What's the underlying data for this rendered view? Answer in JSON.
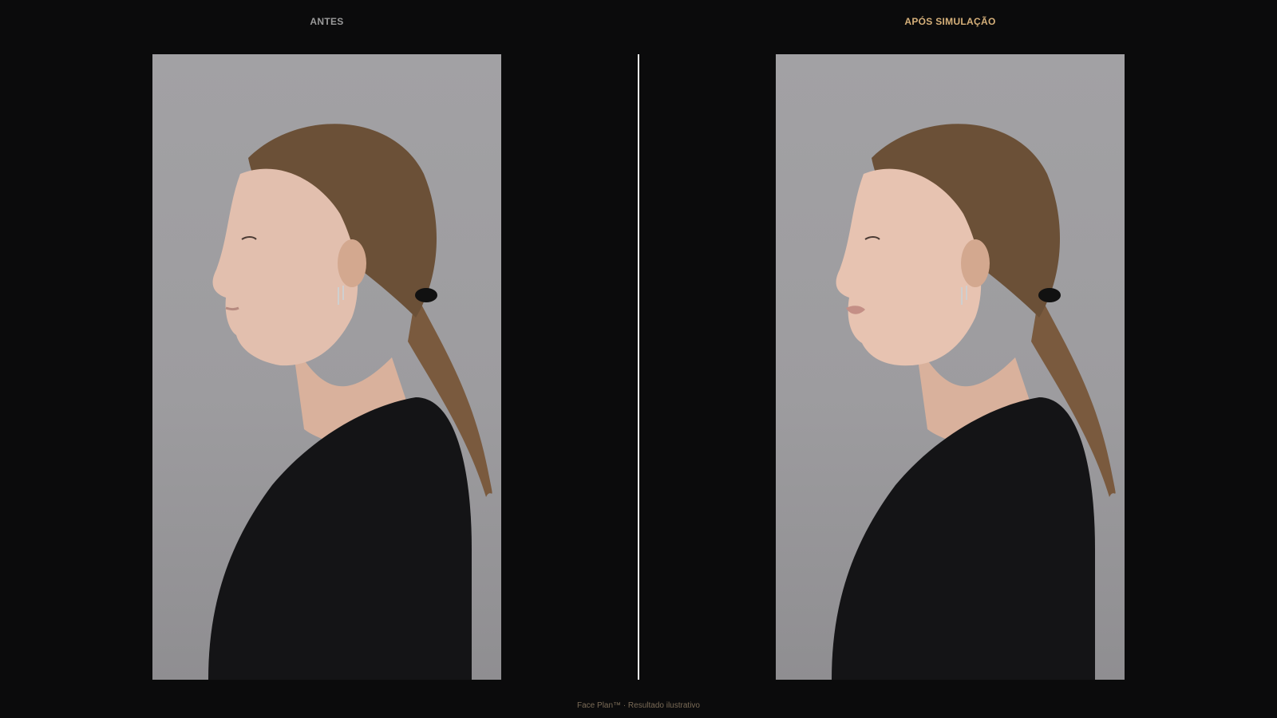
{
  "panels": {
    "before": {
      "label": "ANTES",
      "label_color": "#9a9a9a"
    },
    "after": {
      "label": "APÓS SIMULAÇÃO",
      "label_color": "#d6b07a"
    }
  },
  "footer": {
    "text": "Face Plan™ · Resultado ilustrativo"
  },
  "colors": {
    "background": "#0b0b0c",
    "photo_backdrop": "#a2a1a4",
    "divider": "#f2f2f2",
    "accent": "#d6b07a"
  },
  "images": {
    "before": "woman-profile-left-facing-before",
    "after": "woman-profile-left-facing-after-simulation"
  }
}
